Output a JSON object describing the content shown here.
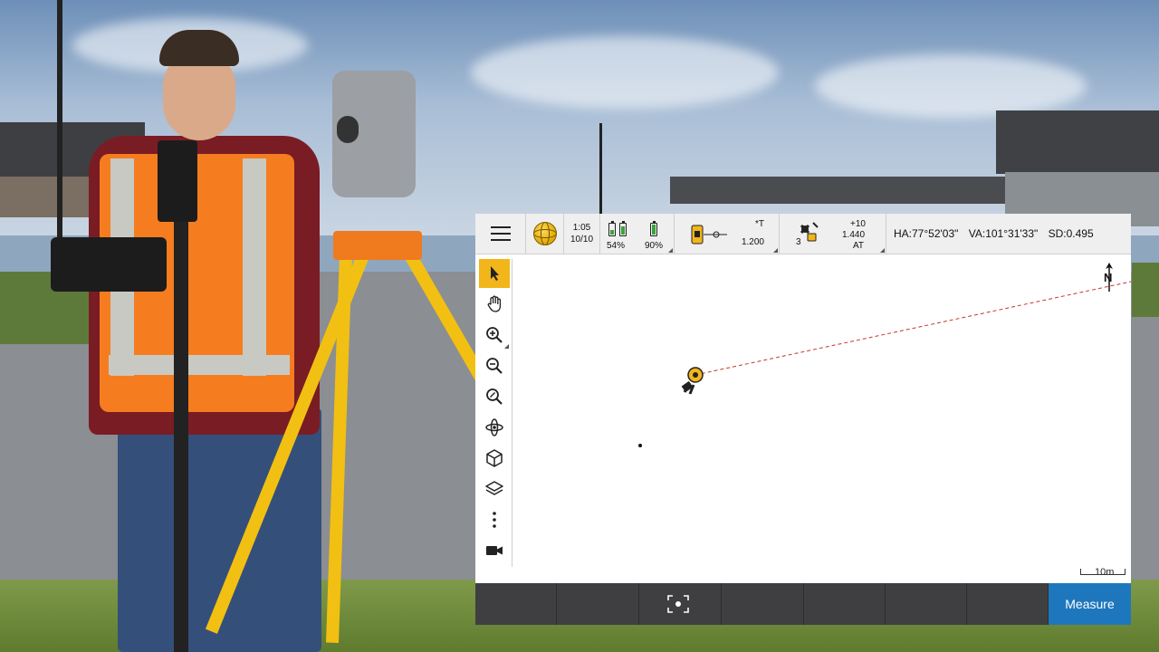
{
  "status_bar": {
    "time": "1:05",
    "date": "10/10",
    "controller_battery": "54%",
    "instrument_battery": "90%",
    "target_label": "*T",
    "target_height": "1.200",
    "satellite_count": "3",
    "sat_offset": "+10",
    "antenna_height": "1.440",
    "sat_mode": "AT",
    "ha_label": "HA:77°52'03\"",
    "va_label": "VA:101°31'33\"",
    "sd_label": "SD:0.495"
  },
  "toolbar": {
    "icons": [
      "select-arrow-icon",
      "pan-hand-icon",
      "zoom-in-icon",
      "zoom-out-icon",
      "zoom-extents-icon",
      "orbit-icon",
      "cube-view-icon",
      "layers-icon",
      "more-icon",
      "video-icon"
    ]
  },
  "map": {
    "north_letter": "N",
    "scale_text": "10m"
  },
  "bottom_bar": {
    "measure_label": "Measure"
  },
  "colors": {
    "accent": "#f2b61a",
    "measure_button": "#1e77bd",
    "bottom_bar": "#3f3f42",
    "line_to_target": "#c0392b"
  }
}
